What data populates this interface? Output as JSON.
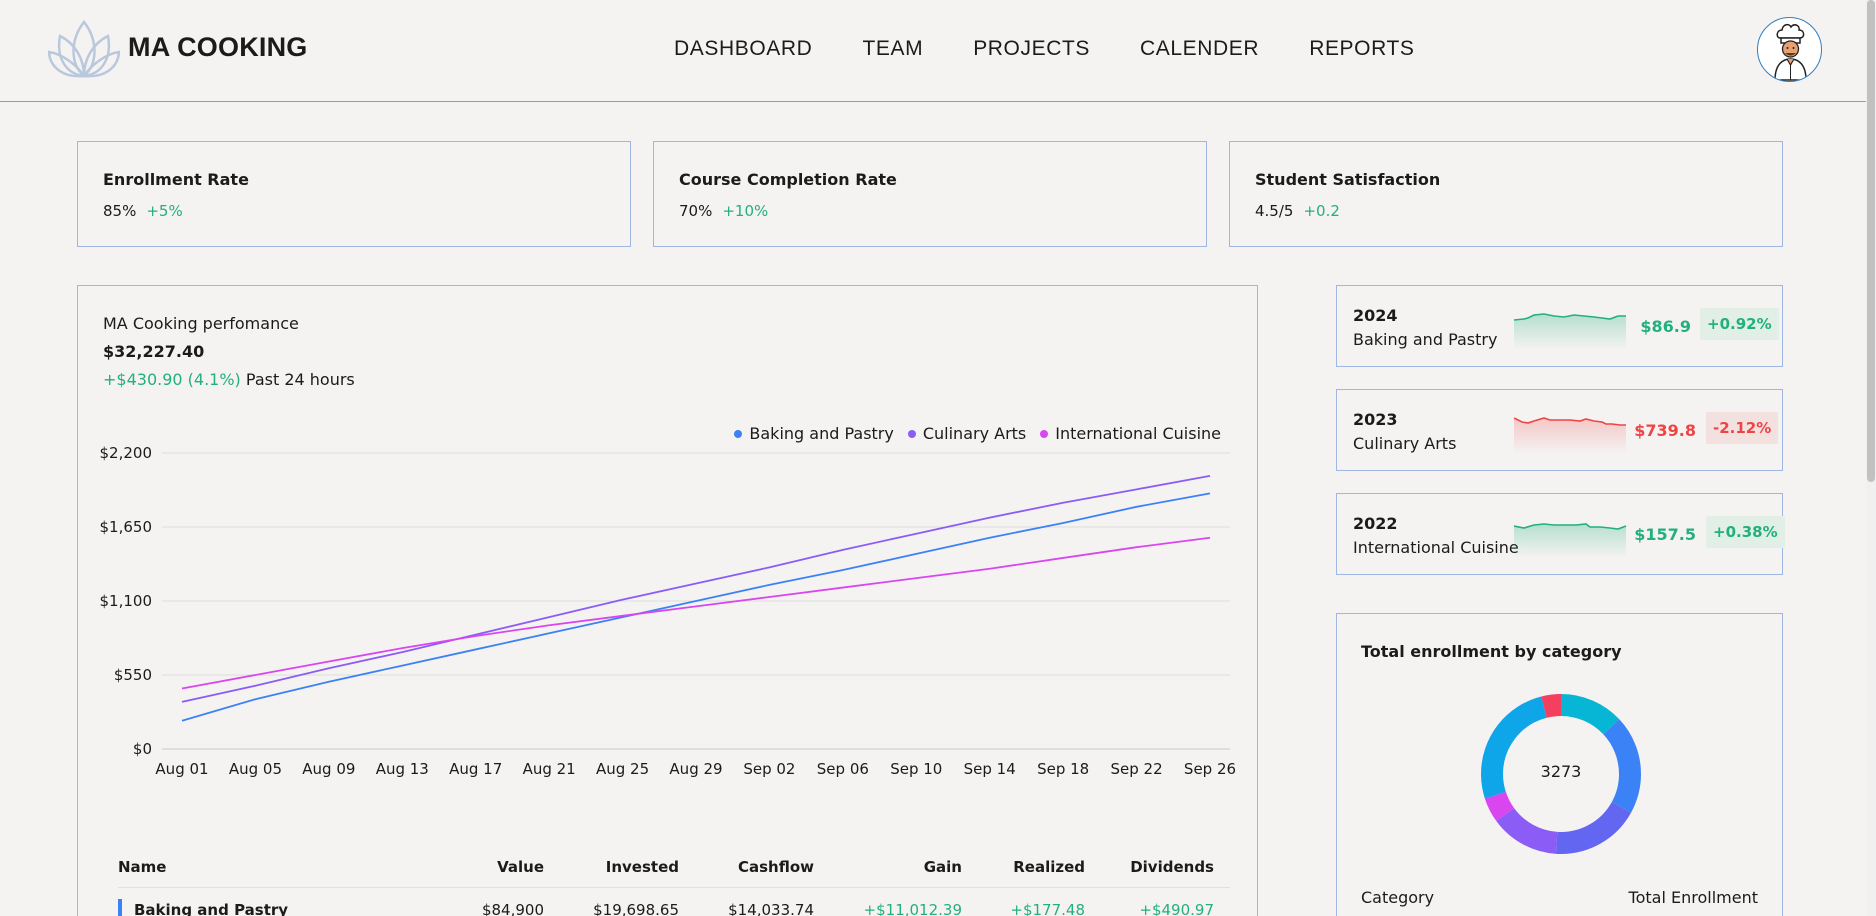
{
  "header": {
    "brand": "MA COOKING",
    "nav": [
      "DASHBOARD",
      "TEAM",
      "PROJECTS",
      "CALENDER",
      "REPORTS"
    ]
  },
  "kpis": [
    {
      "title": "Enrollment Rate",
      "value": "85%",
      "delta": "+5%"
    },
    {
      "title": "Course Completion Rate",
      "value": "70%",
      "delta": "+10%"
    },
    {
      "title": "Student Satisfaction",
      "value": "4.5/5",
      "delta": "+0.2"
    }
  ],
  "performance": {
    "title": "MA Cooking perfomance",
    "value": "$32,227.40",
    "change": "+$430.90 (4.1%)",
    "change_period": "Past 24 hours"
  },
  "chart_data": {
    "type": "line",
    "x": [
      "Aug 01",
      "Aug 05",
      "Aug 09",
      "Aug 13",
      "Aug 17",
      "Aug 21",
      "Aug 25",
      "Aug 29",
      "Sep 02",
      "Sep 06",
      "Sep 10",
      "Sep 14",
      "Sep 18",
      "Sep 22",
      "Sep 26"
    ],
    "y_ticks": [
      "$0",
      "$550",
      "$1,100",
      "$1,650",
      "$2,200"
    ],
    "ylim": [
      0,
      2200
    ],
    "grid": true,
    "legend_position": "top-right",
    "series": [
      {
        "name": "Baking and Pastry",
        "color": "#3b82f6",
        "values": [
          210,
          370,
          500,
          620,
          740,
          860,
          980,
          1100,
          1220,
          1330,
          1450,
          1570,
          1680,
          1800,
          1900
        ]
      },
      {
        "name": "Culinary Arts",
        "color": "#8b5cf6",
        "values": [
          350,
          470,
          600,
          720,
          850,
          980,
          1110,
          1230,
          1350,
          1480,
          1600,
          1720,
          1830,
          1930,
          2030
        ]
      },
      {
        "name": "International Cuisine",
        "color": "#d946ef",
        "values": [
          450,
          550,
          650,
          750,
          840,
          920,
          990,
          1060,
          1130,
          1200,
          1270,
          1340,
          1420,
          1500,
          1570
        ]
      }
    ]
  },
  "table": {
    "headers": [
      "Name",
      "Value",
      "Invested",
      "Cashflow",
      "Gain",
      "Realized",
      "Dividends"
    ],
    "rows": [
      {
        "name": "Baking and Pastry",
        "value": "$84,900",
        "invested": "$19,698.65",
        "cashflow": "$14,033.74",
        "gain": "+$11,012.39",
        "realized": "+$177.48",
        "dividends": "+$490.97"
      }
    ]
  },
  "tickers": [
    {
      "year": "2024",
      "name": "Baking and Pastry",
      "price": "$86.9",
      "pct": "+0.92%",
      "trend": "up",
      "color": "#22b07d",
      "bg": "#e1efe6"
    },
    {
      "year": "2023",
      "name": "Culinary Arts",
      "price": "$739.8",
      "pct": "-2.12%",
      "trend": "down",
      "color": "#ef4444",
      "bg": "#f3e1e0"
    },
    {
      "year": "2022",
      "name": "International Cuisine",
      "price": "$157.5",
      "pct": "+0.38%",
      "trend": "up",
      "color": "#22b07d",
      "bg": "#e1efe6"
    }
  ],
  "enrollment": {
    "title": "Total enrollment by category",
    "total": "3273",
    "footer_left": "Category",
    "footer_right": "Total Enrollment",
    "segment_colors": [
      "#06b6d4",
      "#3b82f6",
      "#6366f1",
      "#8b5cf6",
      "#d946ef",
      "#0ea5e9",
      "#f43f5e"
    ],
    "segment_shares": [
      0.13,
      0.2,
      0.18,
      0.14,
      0.05,
      0.26,
      0.04
    ]
  }
}
